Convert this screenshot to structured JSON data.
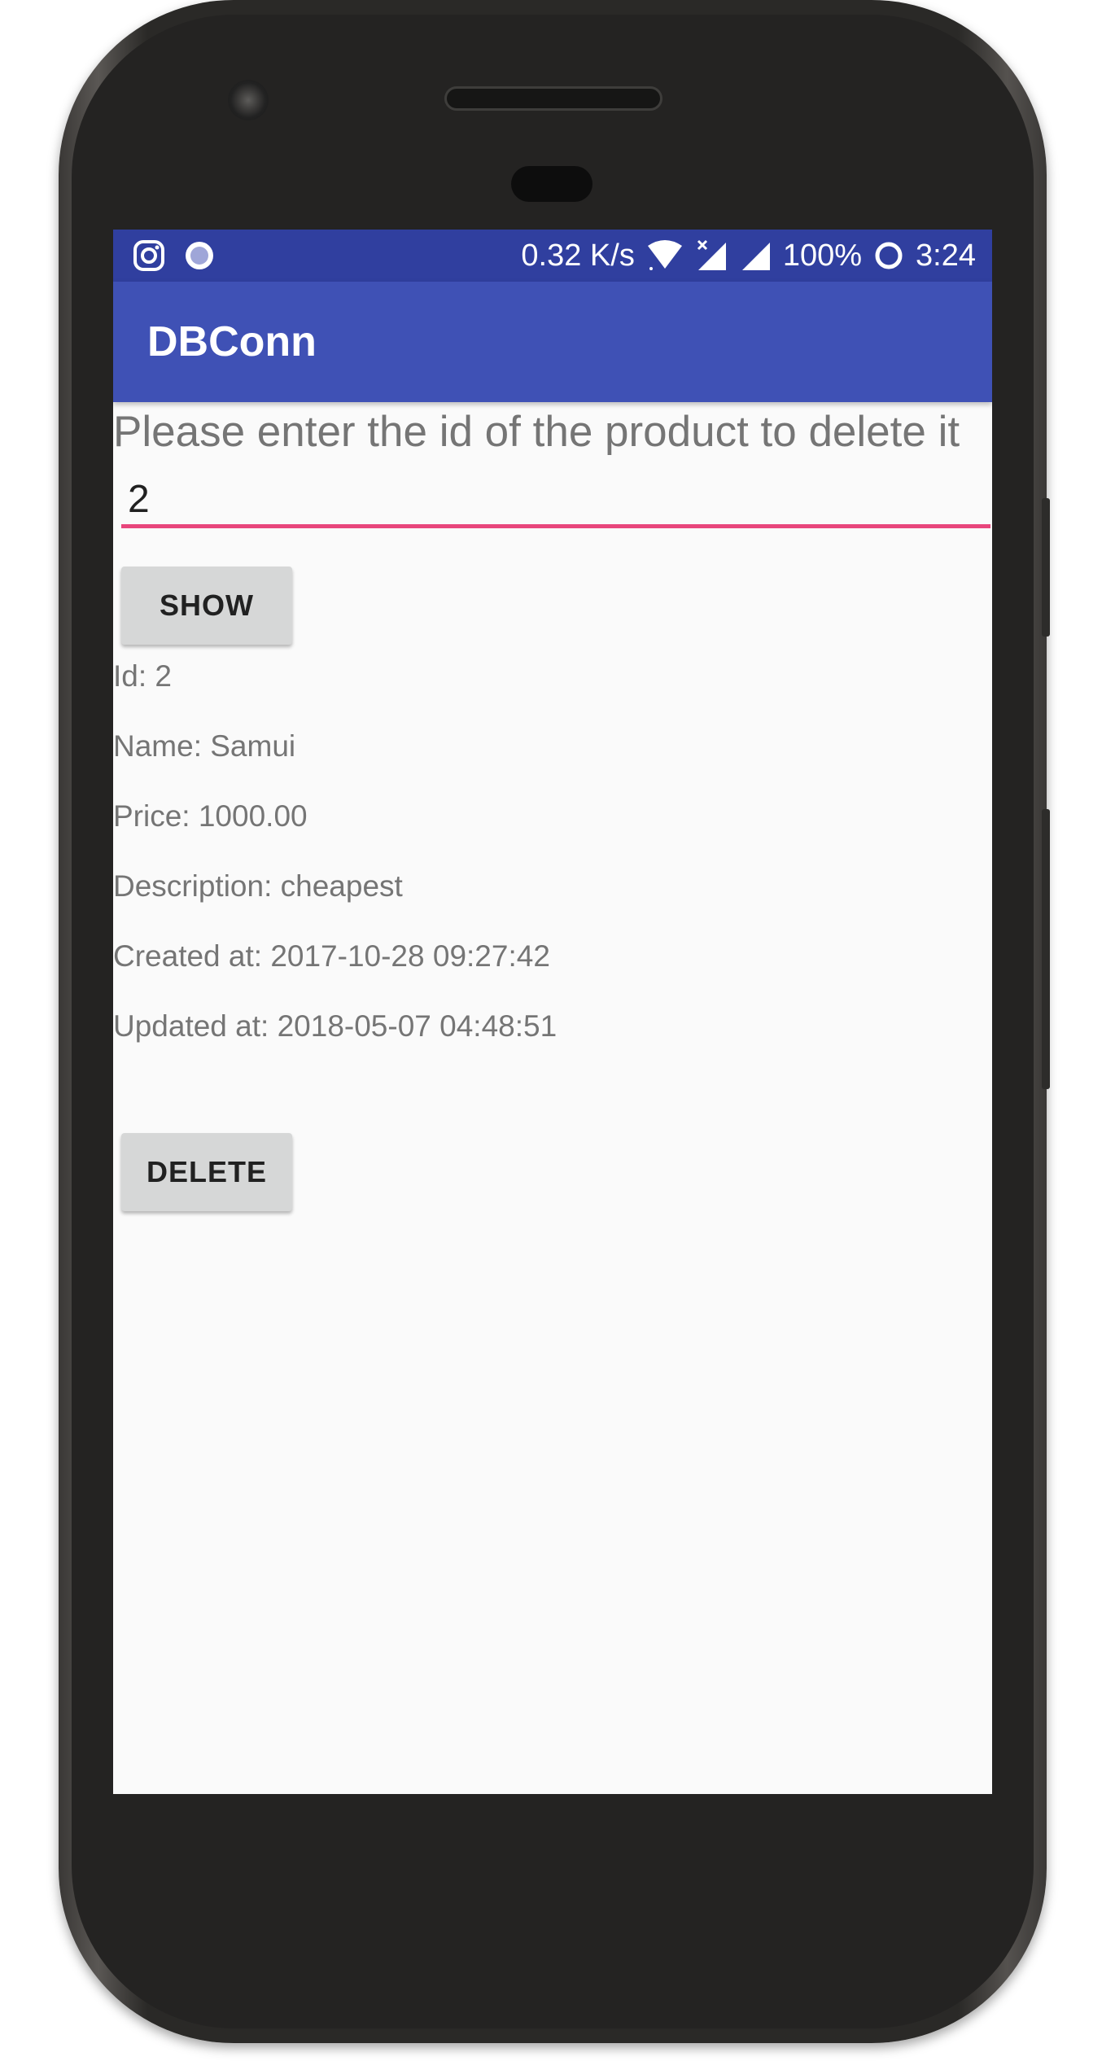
{
  "status_bar": {
    "left_icons": [
      "instagram-icon",
      "circle-notification-icon"
    ],
    "network_speed": "0.32 K/s",
    "battery": "100%",
    "time": "3:24",
    "colors": {
      "background": "#303f9f"
    }
  },
  "app_bar": {
    "title": "DBConn",
    "colors": {
      "background": "#3f51b5"
    }
  },
  "form": {
    "prompt": "Please enter the id of the product to delete it",
    "id_value": "2",
    "show_label": "SHOW",
    "delete_label": "DELETE",
    "accent_color": "#e8467c"
  },
  "product": {
    "id": "Id: 2",
    "name": "Name: Samui",
    "price": "Price: 1000.00",
    "description": "Description: cheapest",
    "created_at": "Created at: 2017-10-28 09:27:42",
    "updated_at": "Updated at: 2018-05-07 04:48:51"
  }
}
